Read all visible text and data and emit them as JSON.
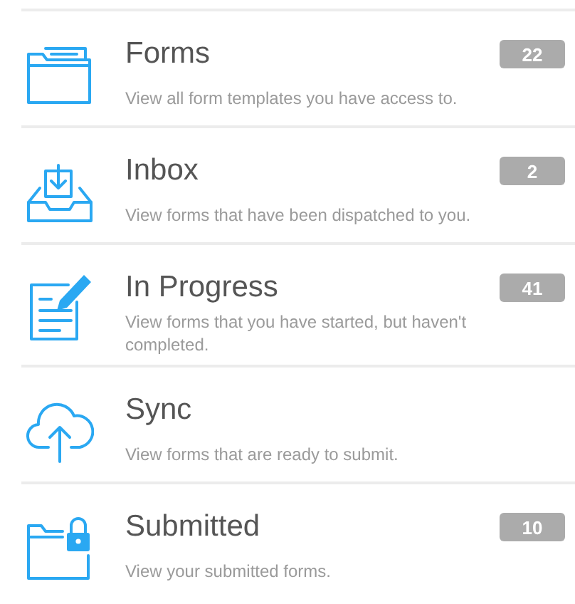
{
  "items": [
    {
      "kind": "folder",
      "title": "Forms",
      "description": "View all form templates you have access to.",
      "count": "22"
    },
    {
      "kind": "inbox",
      "title": "Inbox",
      "description": "View forms that have been dispatched to you.",
      "count": "2"
    },
    {
      "kind": "edit",
      "title": "In Progress",
      "description": "View forms that you have started, but haven't completed.",
      "count": "41"
    },
    {
      "kind": "upload",
      "title": "Sync",
      "description": "View forms that are ready to submit."
    },
    {
      "kind": "locked",
      "title": "Submitted",
      "description": "View your submitted forms.",
      "count": "10"
    }
  ]
}
